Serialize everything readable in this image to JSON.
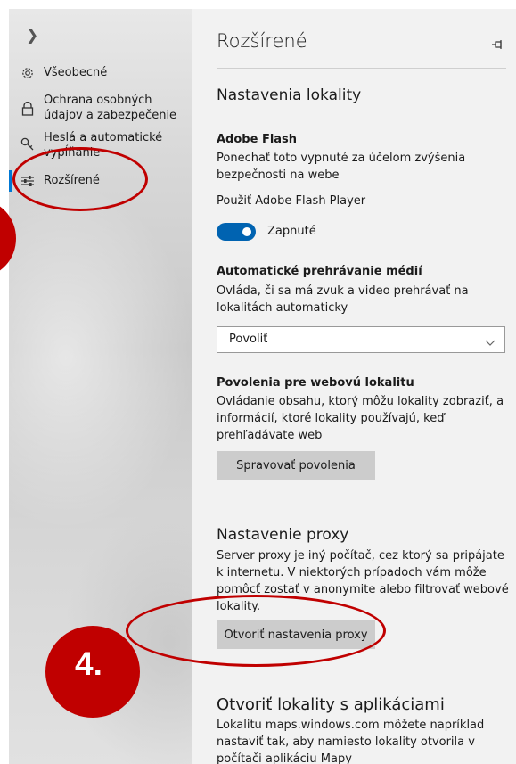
{
  "nav": {
    "expand_icon": "chevron-right-icon",
    "items": [
      {
        "label": "Všeobecné",
        "icon": "gear-icon"
      },
      {
        "label": "Ochrana osobných údajov a zabezpečenie",
        "icon": "lock-icon"
      },
      {
        "label": "Heslá a automatické vypĺňanie",
        "icon": "key-icon"
      },
      {
        "label": "Rozšírené",
        "icon": "sliders-icon",
        "active": true
      }
    ]
  },
  "content": {
    "title": "Rozšírené",
    "pin_icon": "pin-icon",
    "site_settings": {
      "heading": "Nastavenia lokality",
      "flash": {
        "heading": "Adobe Flash",
        "description": "Ponechať toto vypnuté za účelom zvýšenia bezpečnosti na webe",
        "toggle_caption": "Použiť Adobe Flash Player",
        "toggle_state": "Zapnuté"
      },
      "autoplay": {
        "heading": "Automatické prehrávanie médií",
        "description": "Ovláda, či sa má zvuk a video prehrávať na lokalitách automaticky",
        "selected": "Povoliť"
      },
      "permissions": {
        "heading": "Povolenia pre webovú lokalitu",
        "description": "Ovládanie obsahu, ktorý môžu lokality zobraziť, a informácií, ktoré lokality používajú, keď prehľadávate web",
        "button": "Spravovať povolenia"
      }
    },
    "proxy": {
      "heading": "Nastavenie proxy",
      "description": "Server proxy je iný počítač, cez ktorý sa pripájate k internetu. V niektorých prípadoch vám môže pomôcť zostať v anonymite alebo filtrovať webové lokality.",
      "button": "Otvoriť nastavenia proxy"
    },
    "apps": {
      "heading": "Otvoriť lokality s aplikáciami",
      "description": "Lokalitu maps.windows.com môžete napríklad nastaviť tak, aby namiesto lokality otvorila v počítači aplikáciu Mapy"
    }
  },
  "annotations": {
    "step_number": "4.",
    "color": "#c00000"
  },
  "colors": {
    "accent": "#0063b1",
    "active_bar": "#0078d4",
    "content_bg": "#f2f2f2",
    "button_bg": "#cccccc"
  }
}
